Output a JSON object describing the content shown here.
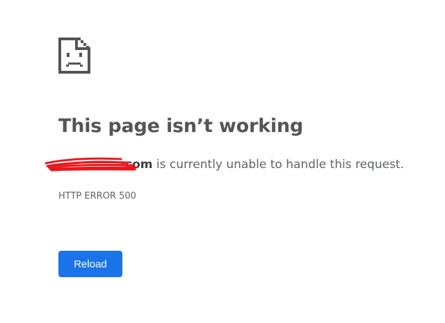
{
  "icon": "sad-page-icon",
  "headline": "This page isn’t working",
  "summary": {
    "domain": "com",
    "text": " is currently unable to handle this request.",
    "redaction_color": "#e8191e"
  },
  "error_code": "HTTP ERROR 500",
  "reload_label": "Reload",
  "colors": {
    "button_bg": "#1a73e8",
    "text": "#5f6368"
  }
}
